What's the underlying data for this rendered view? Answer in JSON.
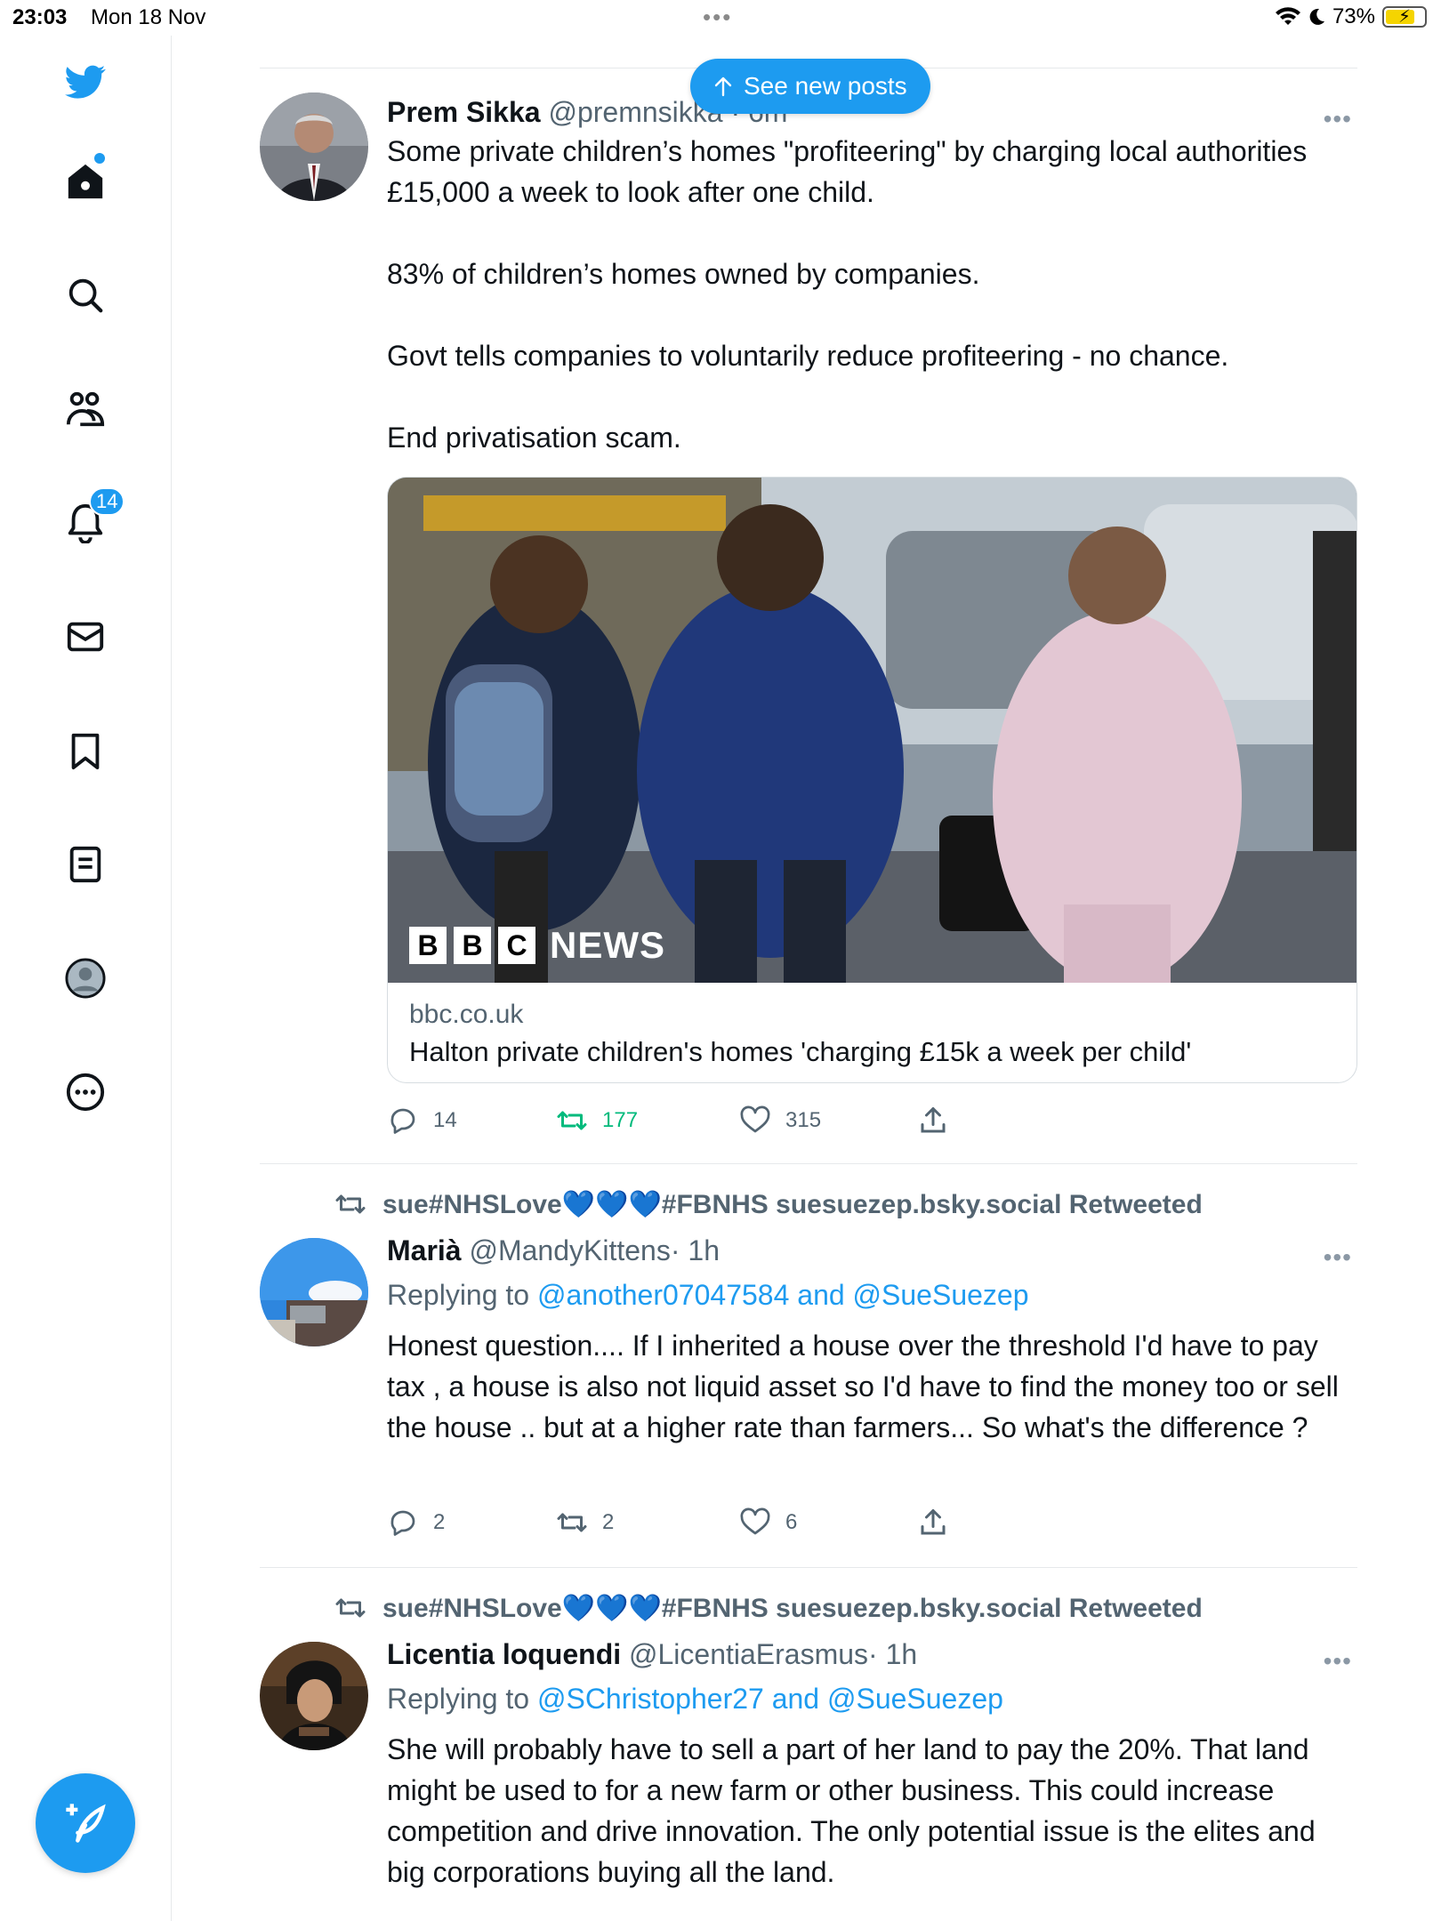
{
  "status_bar": {
    "time": "23:03",
    "date": "Mon 18 Nov",
    "battery": "73%"
  },
  "sidebar": {
    "notifications_count": "14"
  },
  "see_new_posts": "See new posts",
  "tweets": [
    {
      "name": "Prem Sikka",
      "handle": "@premnsikka",
      "time": "· 6m",
      "paragraphs": [
        "Some private children’s homes \"profiteering\" by charging local authorities £15,000 a week to look after one child.",
        "83% of children’s homes owned by companies.",
        "Govt tells companies to voluntarily reduce profiteering - no chance.",
        "End privatisation scam."
      ],
      "card": {
        "brand": [
          "B",
          "B",
          "C"
        ],
        "brand_news": "NEWS",
        "domain": "bbc.co.uk",
        "title": "Halton private children's homes 'charging £15k a week per child'"
      },
      "replies": "14",
      "retweets": "177",
      "likes": "315"
    },
    {
      "retweeted_by": "sue#NHSLove💙💙💙#FBNHS suesuezep.bsky.social Retweeted",
      "name": "Marià",
      "handle": "@MandyKittens",
      "time": "· 1h",
      "replying_prefix": "Replying to ",
      "replying_to": "@another07047584 and @SueSuezep",
      "text": "Honest question.... If I inherited a house over the threshold I'd have to pay tax , a house is also not liquid asset so I'd have to find the money too or sell the house .. but at a higher rate than farmers... So what's the difference ?",
      "replies": "2",
      "retweets": "2",
      "likes": "6"
    },
    {
      "retweeted_by": "sue#NHSLove💙💙💙#FBNHS suesuezep.bsky.social Retweeted",
      "name": "Licentia loquendi",
      "handle": "@LicentiaErasmus",
      "time": "· 1h",
      "replying_prefix": "Replying to ",
      "replying_to": "@SChristopher27 and @SueSuezep",
      "text": "She will probably have to sell a part of her land to pay the 20%. That land might be used to for a new farm or other business. This could increase competition and drive innovation. The only potential issue is the elites and big corporations buying all the land."
    }
  ],
  "colors": {
    "accent": "#1d9bf0",
    "retweet_green": "#00ba7c",
    "muted": "#536471"
  }
}
